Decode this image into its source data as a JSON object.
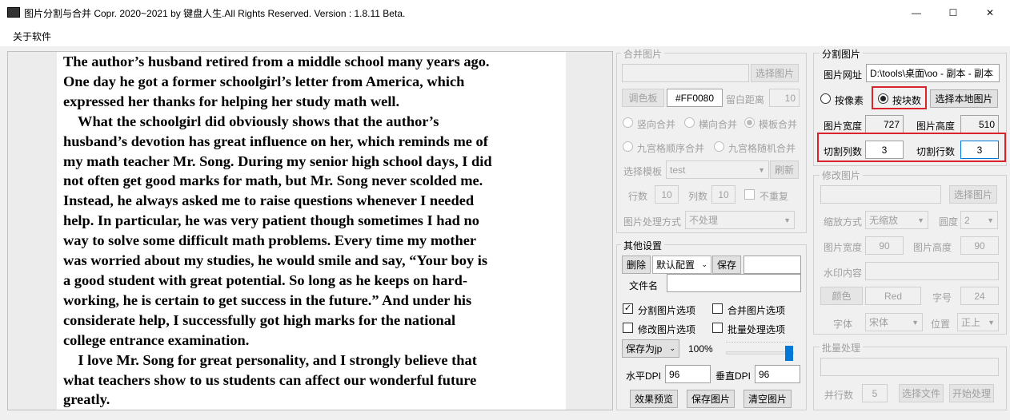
{
  "window": {
    "title": "图片分割与合并    Copr. 2020~2021 by 键盘人生.All Rights Reserved.  Version : 1.8.11 Beta.",
    "minimize": "—",
    "maximize": "☐",
    "close": "✕"
  },
  "menu": {
    "about": "关于软件"
  },
  "document": {
    "lines": [
      "The author’s husband retired from a middle school many years ago.",
      "One day he got a former schoolgirl’s letter from America, which",
      "expressed her thanks for helping her study math well.",
      "    What the schoolgirl did obviously shows that the author’s",
      "husband’s devotion has great influence on her, which reminds me of",
      "my math teacher Mr. Song. During my senior high school days, I did",
      "not often get good marks for math, but Mr. Song never scolded me.",
      "Instead, he always asked me to raise questions whenever I needed",
      "help. In particular, he was very patient though sometimes I had no",
      "way to solve some difficult math problems. Every time my mother",
      "was worried about my studies, he would smile and say, “Your boy is",
      "a good student with great potential. So long as he keeps on hard-",
      "working, he is certain to get success in the future.” And under his",
      "considerate help, I successfully got high marks for the national",
      "college entrance examination.",
      "    I love Mr. Song for great personality, and I strongly believe that",
      "what teachers show to us students can affect our wonderful future",
      "greatly."
    ]
  },
  "merge": {
    "title": "合并图片",
    "select_button": "选择图片",
    "palette_button": "调色板",
    "color_value": "#FF0080",
    "margin_label": "留白距离",
    "margin_value": "10",
    "mode_vertical": "竖向合并",
    "mode_horizontal": "横向合并",
    "mode_template": "模板合并",
    "grid_sequential": "九宫格顺序合并",
    "grid_random": "九宫格随机合并",
    "template_label": "选择模板",
    "template_value": "test",
    "refresh_button": "刷新",
    "rows_label": "行数",
    "rows_value": "10",
    "cols_label": "列数",
    "cols_value": "10",
    "no_repeat": "不重复",
    "process_label": "图片处理方式",
    "process_value": "不处理"
  },
  "other": {
    "title": "其他设置",
    "delete_button": "删除",
    "config_value": "默认配置",
    "save_button": "保存",
    "filename_label": "文件名",
    "split_option": "分割图片选项",
    "merge_option": "合并图片选项",
    "modify_option": "修改图片选项",
    "batch_option": "批量处理选项",
    "save_as_value": "保存为jp",
    "zoom": "100%",
    "hdpi_label": "水平DPI",
    "hdpi_value": "96",
    "vdpi_label": "垂直DPI",
    "vdpi_value": "96",
    "preview_button": "效果预览",
    "save_image_button": "保存图片",
    "clear_button": "清空图片"
  },
  "split": {
    "title": "分割图片",
    "url_label": "图片网址",
    "url_value": "D:\\tools\\桌面\\oo - 副本 - 副本",
    "by_pixel": "按像素",
    "by_block": "按块数",
    "select_local_button": "选择本地图片",
    "width_label": "图片宽度",
    "width_value": "727",
    "height_label": "图片高度",
    "height_value": "510",
    "cols_label": "切割列数",
    "cols_value": "3",
    "rows_label": "切割行数",
    "rows_value": "3"
  },
  "modify": {
    "title": "修改图片",
    "select_button": "选择图片",
    "scale_label": "缩放方式",
    "scale_value": "无缩放",
    "rounded_label": "圆度",
    "rounded_value": "2",
    "width_label": "图片宽度",
    "width_value": "90",
    "height_label": "图片高度",
    "height_value": "90",
    "watermark_label": "水印内容",
    "color_button": "颜色",
    "color_value": "Red",
    "fontsize_label": "字号",
    "fontsize_value": "24",
    "font_label": "字体",
    "font_value": "宋体",
    "position_label": "位置",
    "position_value": "正上"
  },
  "batch": {
    "title": "批量处理",
    "rows_label": "并行数",
    "rows_value": "5",
    "select_folder_button": "选择文件",
    "start_button": "开始处理"
  },
  "colors": {
    "highlight": "#d9232d",
    "slider": "#0078d7"
  }
}
